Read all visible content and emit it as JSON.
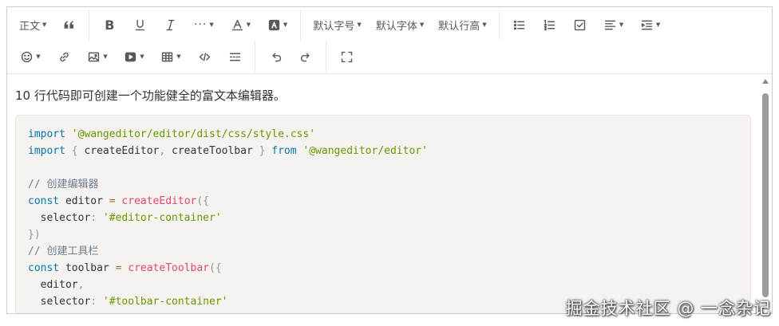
{
  "toolbar": {
    "row1": [
      {
        "type": "select",
        "label": "正文",
        "icon": "header-select"
      },
      {
        "type": "icon",
        "icon": "blockquote-icon"
      },
      {
        "type": "sep"
      },
      {
        "type": "icon",
        "icon": "bold-icon"
      },
      {
        "type": "icon",
        "icon": "underline-icon"
      },
      {
        "type": "icon",
        "icon": "italic-icon"
      },
      {
        "type": "icon-dd",
        "icon": "more-icon"
      },
      {
        "type": "icon-dd",
        "icon": "font-color-icon"
      },
      {
        "type": "icon-dd",
        "icon": "bg-color-icon"
      },
      {
        "type": "sep"
      },
      {
        "type": "select",
        "label": "默认字号",
        "icon": "font-size-select"
      },
      {
        "type": "select",
        "label": "默认字体",
        "icon": "font-family-select"
      },
      {
        "type": "select",
        "label": "默认行高",
        "icon": "line-height-select"
      },
      {
        "type": "sep"
      },
      {
        "type": "icon",
        "icon": "bulleted-list-icon"
      },
      {
        "type": "icon",
        "icon": "numbered-list-icon"
      },
      {
        "type": "icon",
        "icon": "todo-icon"
      },
      {
        "type": "icon-dd",
        "icon": "justify-icon"
      },
      {
        "type": "icon-dd",
        "icon": "indent-icon"
      }
    ],
    "row2": [
      {
        "type": "icon-dd",
        "icon": "emotion-icon"
      },
      {
        "type": "icon",
        "icon": "link-icon"
      },
      {
        "type": "icon-dd",
        "icon": "image-icon"
      },
      {
        "type": "icon-dd",
        "icon": "video-icon"
      },
      {
        "type": "icon-dd",
        "icon": "table-icon"
      },
      {
        "type": "icon",
        "icon": "code-block-icon"
      },
      {
        "type": "icon",
        "icon": "divider-icon"
      },
      {
        "type": "sep"
      },
      {
        "type": "icon",
        "icon": "undo-icon"
      },
      {
        "type": "icon",
        "icon": "redo-icon"
      },
      {
        "type": "sep"
      },
      {
        "type": "icon",
        "icon": "fullscreen-icon"
      }
    ]
  },
  "content": {
    "paragraph": "10 行代码即可创建一个功能健全的富文本编辑器。",
    "code_lines": [
      [
        [
          "keyword",
          "import"
        ],
        [
          "plain",
          " "
        ],
        [
          "string",
          "'@wangeditor/editor/dist/css/style.css'"
        ]
      ],
      [
        [
          "keyword",
          "import"
        ],
        [
          "plain",
          " "
        ],
        [
          "punct",
          "{"
        ],
        [
          "plain",
          " createEditor"
        ],
        [
          "punct",
          ","
        ],
        [
          "plain",
          " createToolbar "
        ],
        [
          "punct",
          "}"
        ],
        [
          "plain",
          " "
        ],
        [
          "keyword",
          "from"
        ],
        [
          "plain",
          " "
        ],
        [
          "string",
          "'@wangeditor/editor'"
        ]
      ],
      [],
      [
        [
          "comment",
          "// 创建编辑器"
        ]
      ],
      [
        [
          "keyword",
          "const"
        ],
        [
          "plain",
          " editor "
        ],
        [
          "op",
          "="
        ],
        [
          "plain",
          " "
        ],
        [
          "func",
          "createEditor"
        ],
        [
          "punct",
          "({"
        ]
      ],
      [
        [
          "plain",
          "  selector"
        ],
        [
          "punct",
          ":"
        ],
        [
          "plain",
          " "
        ],
        [
          "string",
          "'#editor-container'"
        ]
      ],
      [
        [
          "punct",
          "})"
        ]
      ],
      [
        [
          "comment",
          "// 创建工具栏"
        ]
      ],
      [
        [
          "keyword",
          "const"
        ],
        [
          "plain",
          " toolbar "
        ],
        [
          "op",
          "="
        ],
        [
          "plain",
          " "
        ],
        [
          "func",
          "createToolbar"
        ],
        [
          "punct",
          "({"
        ]
      ],
      [
        [
          "plain",
          "  editor"
        ],
        [
          "punct",
          ","
        ]
      ],
      [
        [
          "plain",
          "  selector"
        ],
        [
          "punct",
          ":"
        ],
        [
          "plain",
          " "
        ],
        [
          "string",
          "'#toolbar-container'"
        ]
      ]
    ]
  },
  "watermark": "掘金技术社区 @ 一念杂记"
}
